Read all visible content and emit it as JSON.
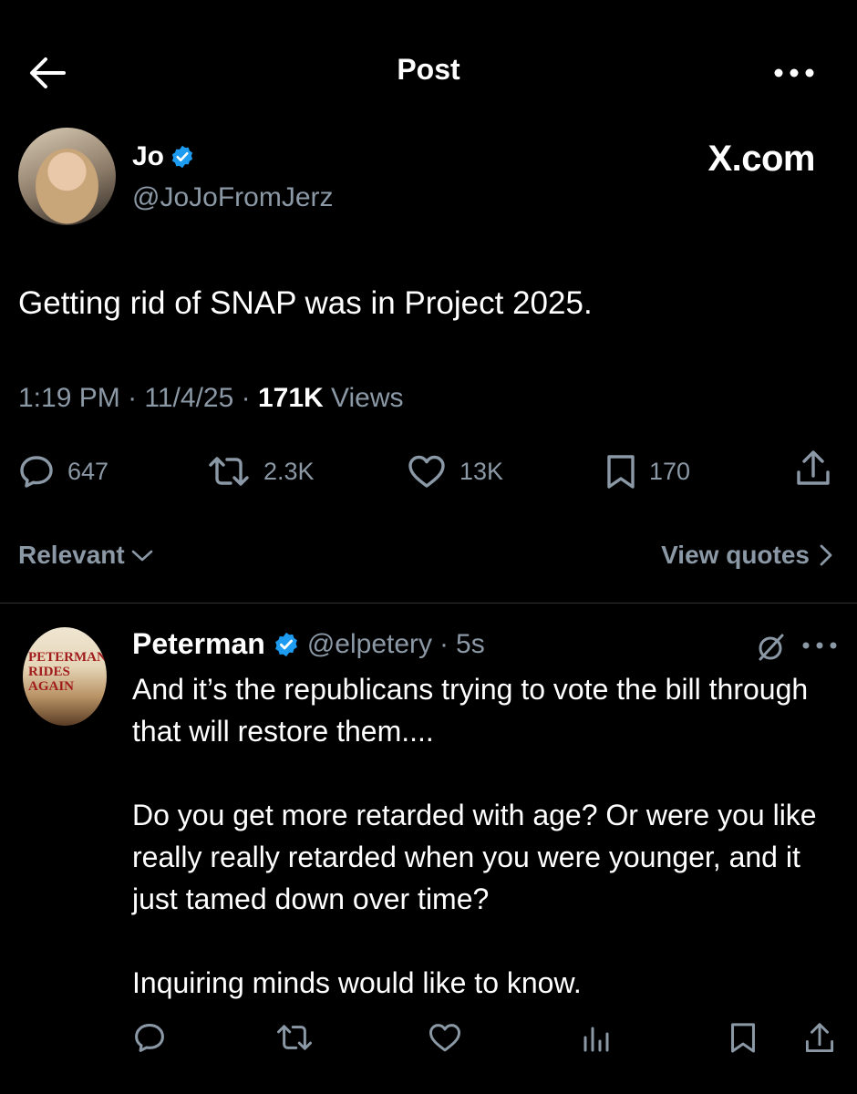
{
  "header": {
    "title": "Post"
  },
  "post": {
    "author_name": "Jo",
    "author_handle": "@JoJoFromJerz",
    "watermark": "X.com",
    "text": "Getting rid of SNAP was in Project 2025.",
    "time": "1:19 PM",
    "date": "11/4/25",
    "views_count": "171K",
    "views_label": "Views",
    "stats": {
      "replies": "647",
      "reposts": "2.3K",
      "likes": "13K",
      "bookmarks": "170"
    }
  },
  "sort": {
    "label": "Relevant",
    "view_quotes": "View quotes"
  },
  "reply": {
    "avatar_text": [
      "PETERMAN",
      "RIDES",
      "AGAIN"
    ],
    "author_name": "Peterman",
    "author_handle": "@elpetery",
    "time": "5s",
    "text": "And it’s the republicans trying to vote the bill through that will restore them....\n\nDo you get more retarded with age? Or were you like really really retarded when you were younger, and it just tamed down over time?\n\nInquiring minds would like to know."
  },
  "colors": {
    "background": "#000000",
    "text": "#e7e9ea",
    "muted": "#8b98a5",
    "verified": "#1d9bf0",
    "divider": "#2f3336"
  }
}
